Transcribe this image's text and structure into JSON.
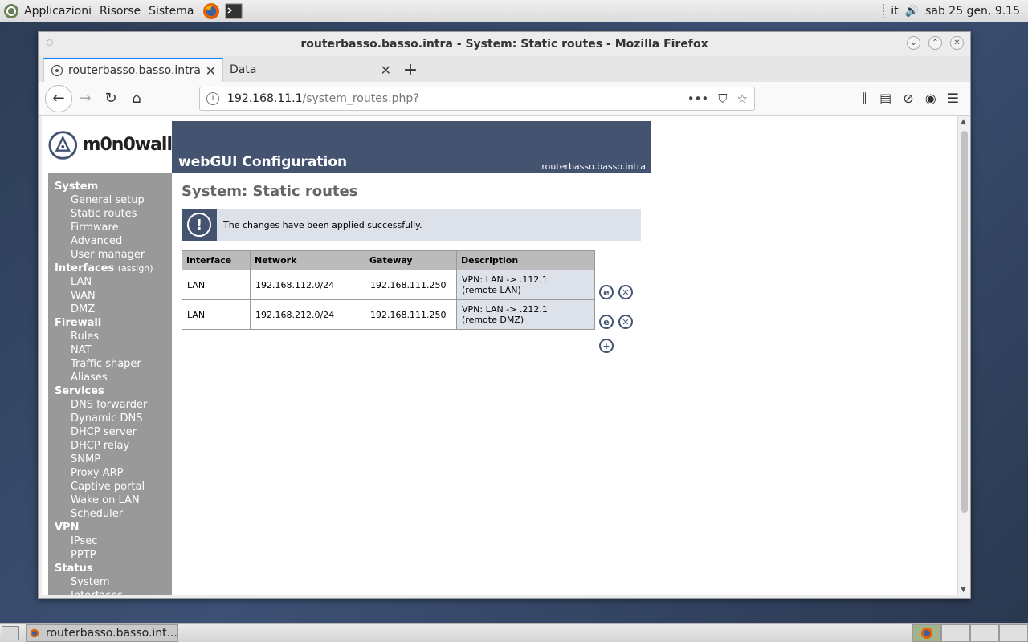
{
  "top_panel": {
    "menu_apps": "Applicazioni",
    "menu_places": "Risorse",
    "menu_system": "Sistema",
    "keyboard": "it",
    "clock": "sab 25 gen,  9.15"
  },
  "window": {
    "title": "routerbasso.basso.intra - System: Static routes - Mozilla Firefox"
  },
  "tabs": [
    {
      "label": "routerbasso.basso.intra - System: Static routes"
    },
    {
      "label": "Data"
    }
  ],
  "url": {
    "host": "192.168.11.1",
    "path": "/system_routes.php?"
  },
  "page": {
    "logo_text": "m0n0wall",
    "header_title": "webGUI Configuration",
    "header_host": "routerbasso.basso.intra",
    "title": "System: Static routes",
    "info_message": "The changes have been applied successfully.",
    "sidebar": {
      "system": {
        "title": "System",
        "items": [
          "General setup",
          "Static routes",
          "Firmware",
          "Advanced",
          "User manager"
        ]
      },
      "interfaces": {
        "title": "Interfaces",
        "assign": "(assign)",
        "items": [
          "LAN",
          "WAN",
          "DMZ"
        ]
      },
      "firewall": {
        "title": "Firewall",
        "items": [
          "Rules",
          "NAT",
          "Traffic shaper",
          "Aliases"
        ]
      },
      "services": {
        "title": "Services",
        "items": [
          "DNS forwarder",
          "Dynamic DNS",
          "DHCP server",
          "DHCP relay",
          "SNMP",
          "Proxy ARP",
          "Captive portal",
          "Wake on LAN",
          "Scheduler"
        ]
      },
      "vpn": {
        "title": "VPN",
        "items": [
          "IPsec",
          "PPTP"
        ]
      },
      "status": {
        "title": "Status",
        "items": [
          "System",
          "Interfaces"
        ]
      }
    },
    "table": {
      "headers": [
        "Interface",
        "Network",
        "Gateway",
        "Description"
      ],
      "rows": [
        {
          "interface": "LAN",
          "network": "192.168.112.0/24",
          "gateway": "192.168.111.250",
          "desc1": "VPN: LAN -> .112.1",
          "desc2": "(remote LAN)"
        },
        {
          "interface": "LAN",
          "network": "192.168.212.0/24",
          "gateway": "192.168.111.250",
          "desc1": "VPN: LAN -> .212.1",
          "desc2": "(remote DMZ)"
        }
      ]
    }
  },
  "taskbar": {
    "task_label": "routerbasso.basso.int..."
  }
}
